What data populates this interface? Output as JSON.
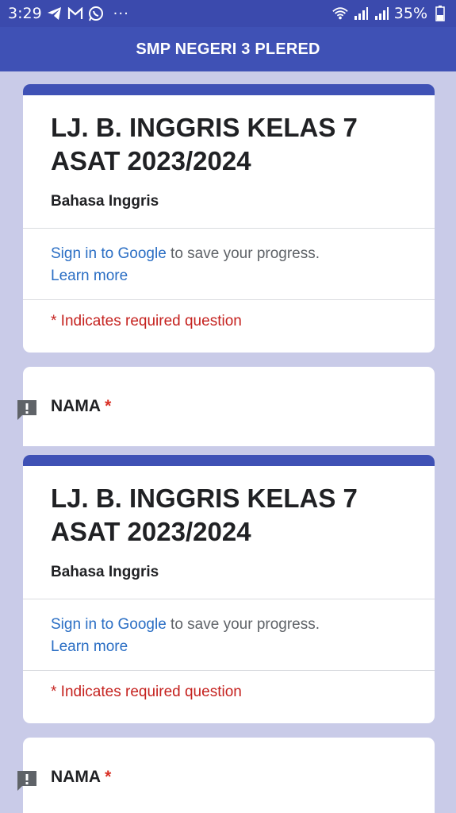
{
  "status_bar": {
    "time": "3:29",
    "left_icons": [
      "telegram-icon",
      "gmail-icon",
      "whatsapp-icon"
    ],
    "more": "···",
    "battery_percent": "35%",
    "right_icons": [
      "wifi-icon",
      "signal-icon",
      "signal-icon",
      "battery-icon"
    ]
  },
  "app_bar": {
    "title": "SMP NEGERI 3 PLERED"
  },
  "forms": [
    {
      "title": "LJ. B. INGGRIS KELAS 7 ASAT 2023/2024",
      "subtitle": "Bahasa Inggris",
      "signin_link": "Sign in to Google",
      "signin_rest": " to save your progress.",
      "learn_more": "Learn more",
      "required_note": "* Indicates required question",
      "question": {
        "label": "NAMA",
        "required_mark": "*"
      }
    },
    {
      "title": "LJ. B. INGGRIS KELAS 7 ASAT 2023/2024",
      "subtitle": "Bahasa Inggris",
      "signin_link": "Sign in to Google",
      "signin_rest": " to save your progress.",
      "learn_more": "Learn more",
      "required_note": "* Indicates required question",
      "question": {
        "label": "NAMA",
        "required_mark": "*"
      }
    }
  ],
  "colors": {
    "status_bar": "#3b4aad",
    "app_bar": "#3f51b5",
    "background": "#c9cbe8",
    "link": "#2a6ec4",
    "required": "#c5221f"
  }
}
